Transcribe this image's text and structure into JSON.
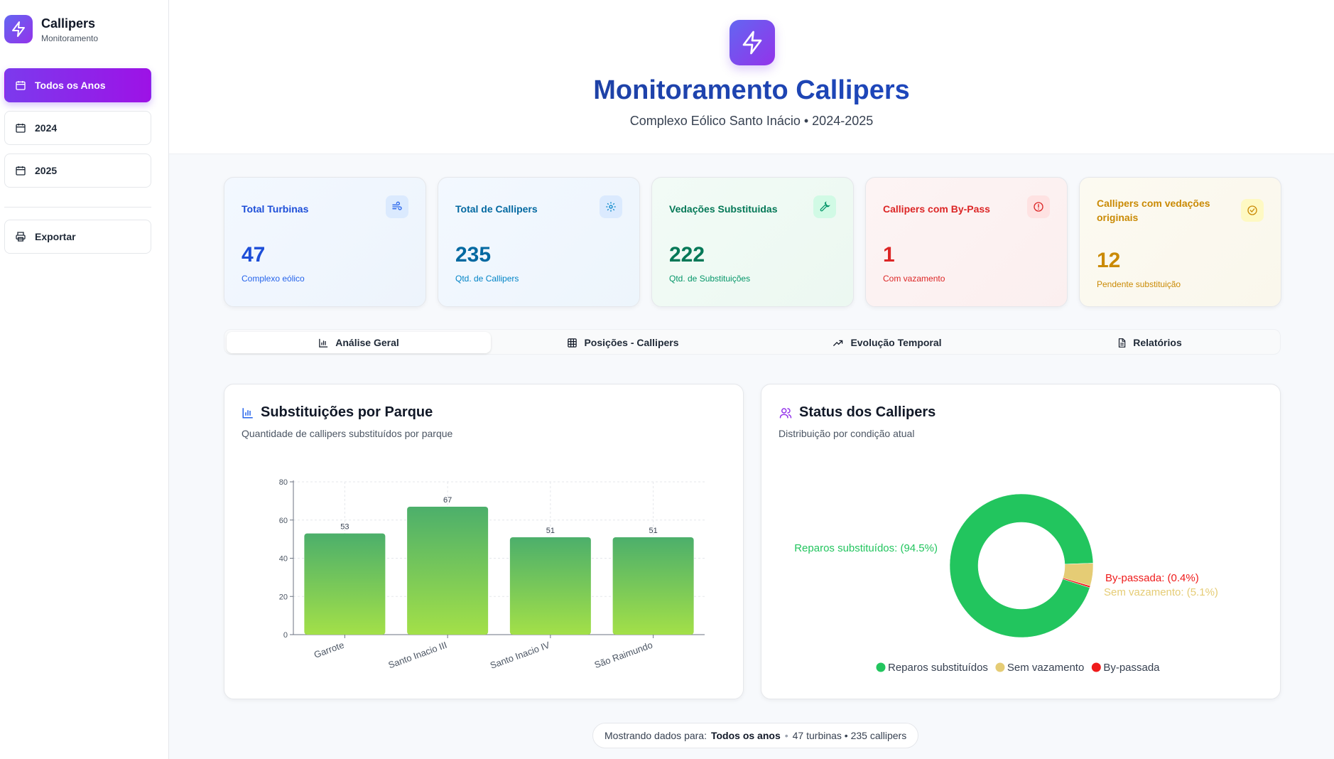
{
  "sidebar": {
    "brand_title": "Callipers",
    "brand_sub": "Monitoramento",
    "nav": [
      {
        "label": "Todos os Anos",
        "active": true
      },
      {
        "label": "2024",
        "active": false
      },
      {
        "label": "2025",
        "active": false
      }
    ],
    "export_label": "Exportar"
  },
  "header": {
    "title": "Monitoramento Callipers",
    "subtitle": "Complexo Eólico Santo Inácio • 2024-2025"
  },
  "kpis": [
    {
      "label": "Total Turbinas",
      "value": "47",
      "desc": "Complexo eólico",
      "icon": "wind-icon",
      "color": "#1d4ed8",
      "bg": "#eff6ff"
    },
    {
      "label": "Total de Callipers",
      "value": "235",
      "desc": "Qtd. de Callipers",
      "icon": "gear-icon",
      "color": "#0369a1",
      "bg": "#eff6ff"
    },
    {
      "label": "Vedações Substituidas",
      "value": "222",
      "desc": "Qtd. de Substituições",
      "icon": "wrench-icon",
      "color": "#047857",
      "bg": "#ecfdf5"
    },
    {
      "label": "Callipers com By-Pass",
      "value": "1",
      "desc": "Com vazamento",
      "icon": "alert-circle-icon",
      "color": "#dc2626",
      "bg": "#fef2f2"
    },
    {
      "label": "Callipers com vedações originais",
      "value": "12",
      "desc": "Pendente substituição",
      "icon": "check-circle-icon",
      "color": "#ca8a04",
      "bg": "#fefce8"
    }
  ],
  "tabs": [
    {
      "label": "Análise Geral",
      "icon": "bar-chart-icon",
      "active": true
    },
    {
      "label": "Posições - Callipers",
      "icon": "grid-icon",
      "active": false
    },
    {
      "label": "Evolução Temporal",
      "icon": "trending-up-icon",
      "active": false
    },
    {
      "label": "Relatórios",
      "icon": "document-icon",
      "active": false
    }
  ],
  "bar_card": {
    "title": "Substituições por Parque",
    "subtitle": "Quantidade de callipers substituídos por parque"
  },
  "pie_card": {
    "title": "Status dos Callipers",
    "subtitle": "Distribuição por condição atual"
  },
  "chart_data": [
    {
      "type": "bar",
      "categories": [
        "Garrote",
        "Santo Inacio III",
        "Santo Inacio IV",
        "São Raimundo"
      ],
      "values": [
        53,
        67,
        51,
        51
      ],
      "ylim": [
        0,
        80
      ],
      "yticks": [
        0,
        20,
        40,
        60,
        80
      ],
      "grid": true,
      "colors": {
        "top": "#4caf6b",
        "bottom": "#a3e048"
      }
    },
    {
      "type": "pie",
      "donut": true,
      "slices": [
        {
          "name": "Reparos substituídos",
          "value": 94.5,
          "label": "Reparos substituídos: (94.5%)",
          "color": "#22c55e"
        },
        {
          "name": "Sem vazamento",
          "value": 5.1,
          "label": "Sem vazamento: (5.1%)",
          "color": "#e5cc75"
        },
        {
          "name": "By-passada",
          "value": 0.4,
          "label": "By-passada: (0.4%)",
          "color": "#ef1b1b"
        }
      ],
      "legend": "bottom"
    }
  ],
  "footer": {
    "prefix": "Mostrando dados para:",
    "period": "Todos os anos",
    "stats": "47 turbinas • 235 callipers"
  }
}
